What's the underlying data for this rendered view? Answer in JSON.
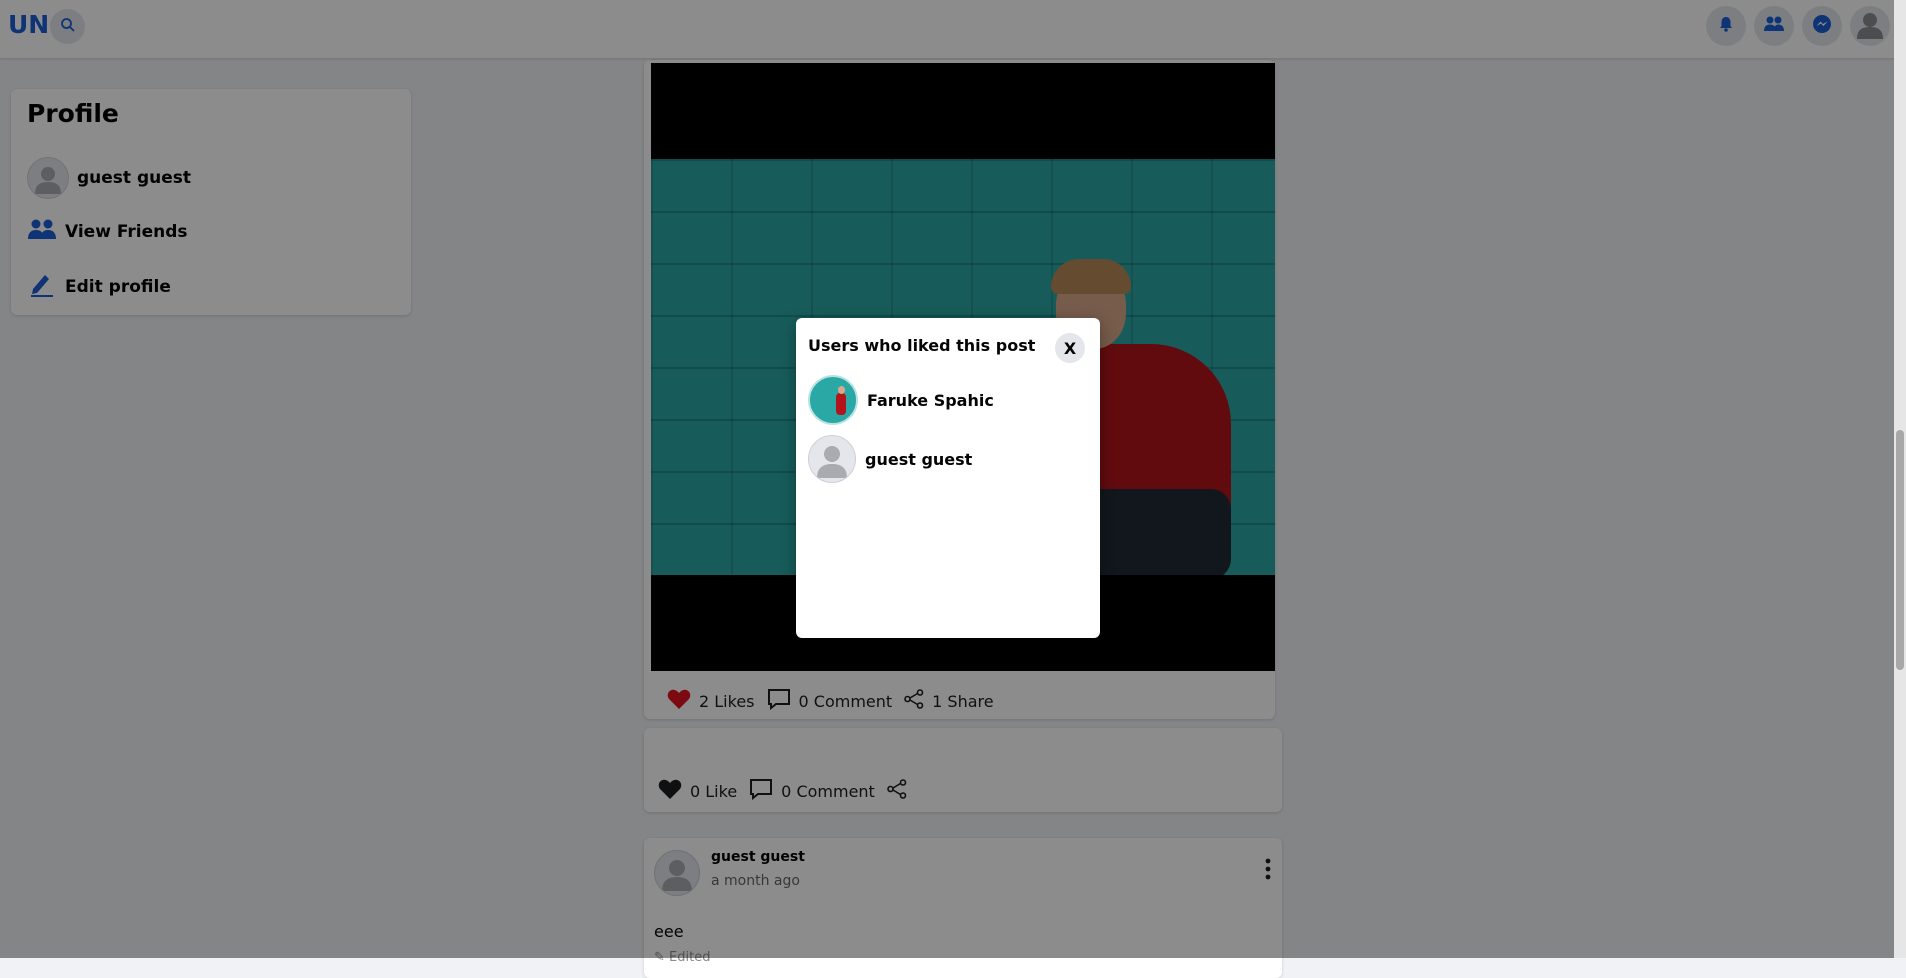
{
  "topbar": {
    "logo": "UN",
    "icons": [
      "search-icon",
      "bell-icon",
      "friends-icon",
      "messenger-icon",
      "user-avatar-icon"
    ]
  },
  "sidebar": {
    "title": "Profile",
    "user_name": "guest  guest",
    "view_friends": "View  Friends",
    "edit_profile": "Edit  profile"
  },
  "post1": {
    "likes": "2 Likes",
    "comments": "0 Comment",
    "shares": "1 Share"
  },
  "post2": {
    "likes": "0 Like",
    "comments": "0 Comment"
  },
  "post3": {
    "author": "guest guest",
    "time": "a month ago",
    "text": "eee",
    "edited": "✎ Edited"
  },
  "modal": {
    "title": "Users who liked this post",
    "close_label": "X",
    "users": [
      {
        "name": "Faruke  Spahic"
      },
      {
        "name": "guest  guest"
      }
    ]
  },
  "colors": {
    "brand": "#1a5fd8",
    "like_red": "#e0141e",
    "overlay": "rgba(0,0,0,0.45)"
  }
}
